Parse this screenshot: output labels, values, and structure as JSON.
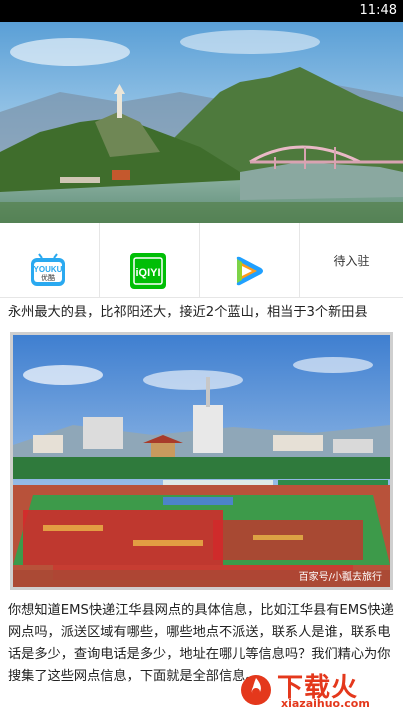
{
  "status_bar": {
    "time": "11:48"
  },
  "apps": [
    {
      "name": "youku",
      "icon": "youku-icon",
      "logo_text": "YOUKU",
      "logo_text2": "优酷"
    },
    {
      "name": "iqiyi",
      "icon": "iqiyi-icon",
      "logo_text": "iQIYI"
    },
    {
      "name": "tencent-video",
      "icon": "tencent-video-icon"
    },
    {
      "name": "pending",
      "label": "待入驻"
    }
  ],
  "caption": "永州最大的县，比祁阳还大，接近2个蓝山，相当于3个新田县",
  "photo": {
    "watermark": "百家号/小瓢去旅行"
  },
  "article": {
    "text": "你想知道EMS快递江华县网点的具体信息，比如江华县有EMS快递网点吗，派送区域有哪些，哪些地点不派送，联系人是谁，联系电话是多少，查询电话是多少，地址在哪儿等信息吗？我们精心为你搜集了这些网点信息，下面就是全部信息。"
  },
  "logo": {
    "main": "下载火",
    "sub": "xiazaihuo.com"
  },
  "colors": {
    "brand": "#e4381c",
    "iqiyi": "#00be06"
  }
}
